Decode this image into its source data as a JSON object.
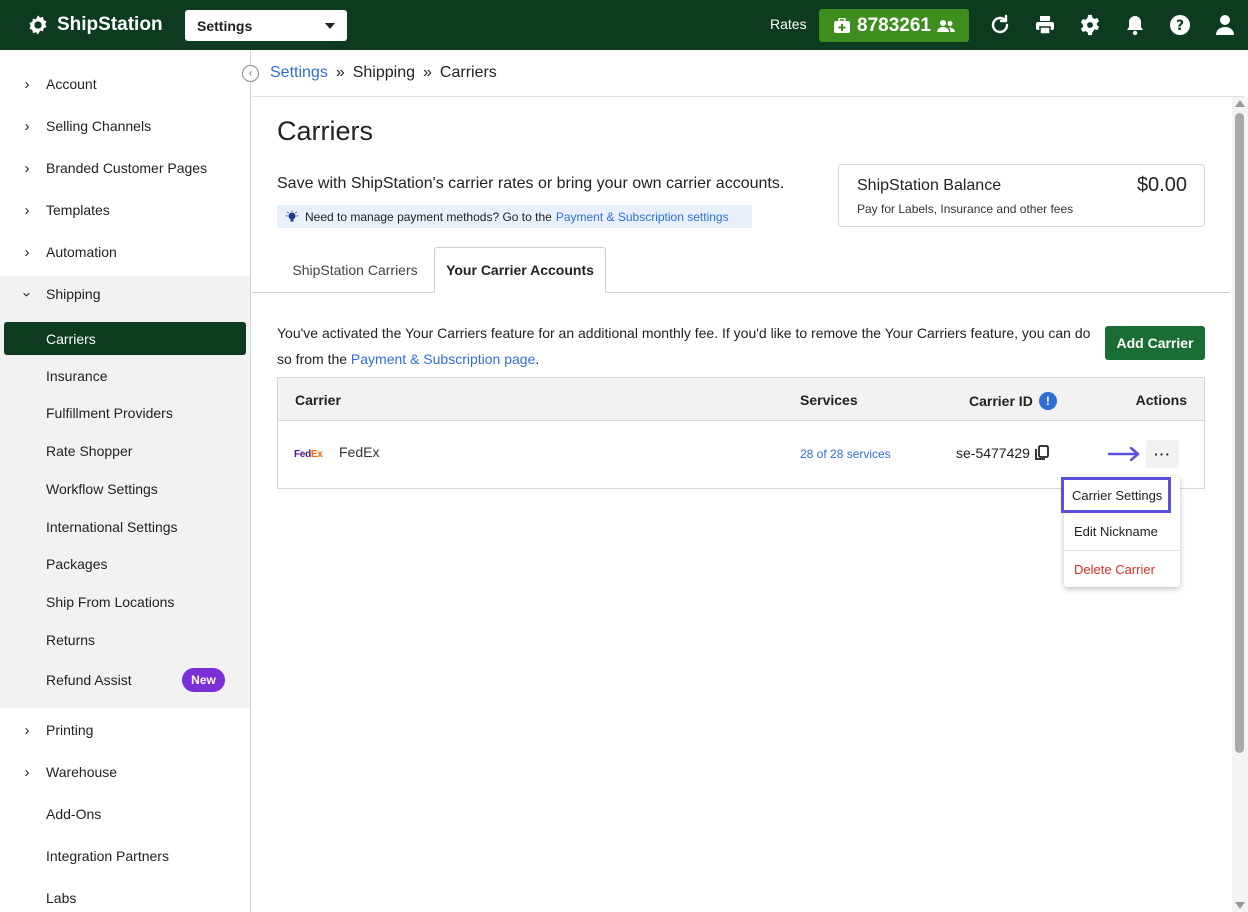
{
  "topbar": {
    "brand": "ShipStation",
    "settings_select": "Settings",
    "rates_label": "Rates",
    "rates_value": "8783261"
  },
  "sidebar": {
    "items_top": [
      {
        "label": "Account"
      },
      {
        "label": "Selling Channels"
      },
      {
        "label": "Branded Customer Pages"
      },
      {
        "label": "Templates"
      },
      {
        "label": "Automation"
      },
      {
        "label": "Shipping"
      }
    ],
    "shipping_sub": [
      {
        "label": "Carriers"
      },
      {
        "label": "Insurance"
      },
      {
        "label": "Fulfillment Providers"
      },
      {
        "label": "Rate Shopper"
      },
      {
        "label": "Workflow Settings"
      },
      {
        "label": "International Settings"
      },
      {
        "label": "Packages"
      },
      {
        "label": "Ship From Locations"
      },
      {
        "label": "Returns"
      },
      {
        "label": "Refund Assist"
      }
    ],
    "new_badge": "New",
    "items_bottom": [
      {
        "label": "Printing"
      },
      {
        "label": "Warehouse"
      },
      {
        "label": "Add-Ons"
      },
      {
        "label": "Integration Partners"
      },
      {
        "label": "Labs"
      }
    ]
  },
  "breadcrumb": {
    "root": "Settings",
    "sep": "»",
    "mid": "Shipping",
    "current": "Carriers"
  },
  "page": {
    "title": "Carriers",
    "intro": "Save with ShipStation's carrier rates or bring your own carrier accounts.",
    "notice_text": "Need to manage payment methods? Go to the",
    "notice_link": "Payment & Subscription settings"
  },
  "balance": {
    "title": "ShipStation Balance",
    "subtitle": "Pay for Labels, Insurance and other fees",
    "amount": "$0.00"
  },
  "tabs": [
    {
      "label": "ShipStation Carriers"
    },
    {
      "label": "Your Carrier Accounts"
    }
  ],
  "feature": {
    "text": "You've activated the Your Carriers feature for an additional monthly fee. If you'd like to remove the Your Carriers feature, you can do so from the",
    "link": "Payment & Subscription page",
    "end": ".",
    "add_button": "Add Carrier"
  },
  "table": {
    "headers": {
      "carrier": "Carrier",
      "services": "Services",
      "carrier_id": "Carrier ID",
      "actions": "Actions"
    },
    "rows": [
      {
        "logo_fed": "Fed",
        "logo_ex": "Ex",
        "carrier": "FedEx",
        "services": "28 of 28 services",
        "carrier_id": "se-5477429",
        "actions": "···"
      }
    ]
  },
  "actions_menu": [
    {
      "label": "Carrier Settings"
    },
    {
      "label": "Edit Nickname"
    },
    {
      "label": "Delete Carrier"
    }
  ],
  "colors": {
    "topbar": "#0d3b1f",
    "rates_badge": "#3e8e1f",
    "link": "#2e6fd6",
    "primary_button": "#1a6e35",
    "highlight": "#5b4fe0",
    "danger": "#d93025",
    "new_badge": "#7b2fd6"
  }
}
